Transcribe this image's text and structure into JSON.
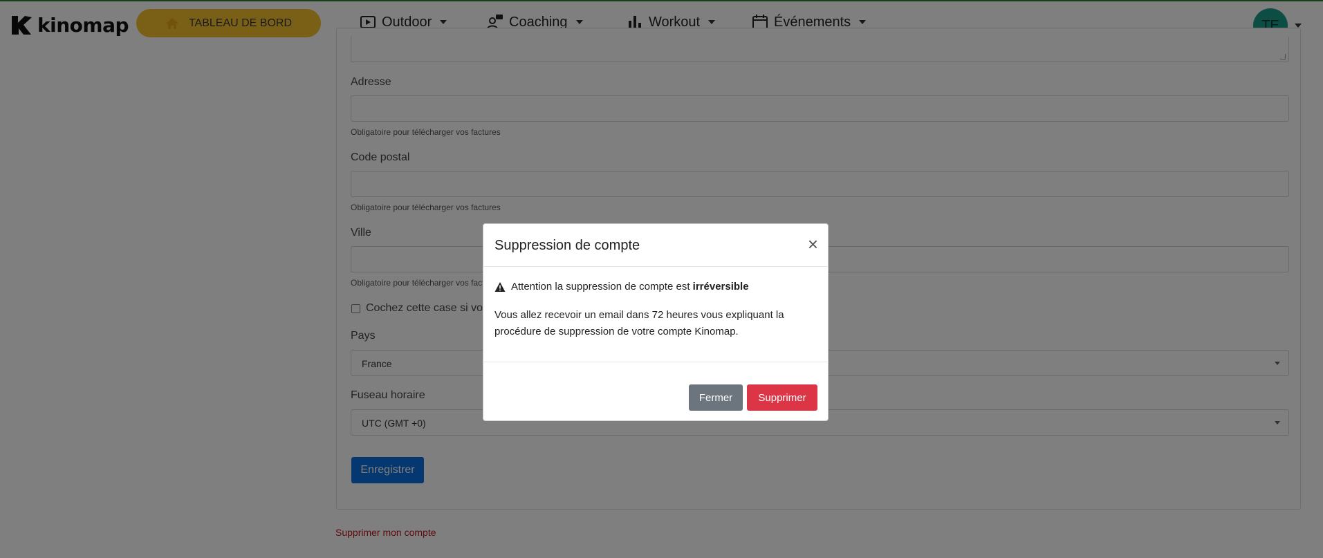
{
  "navbar": {
    "logo_text": "kinomap",
    "dashboard_label": "TABLEAU DE BORD",
    "items": [
      {
        "label": "Outdoor",
        "icon": "play-icon"
      },
      {
        "label": "Coaching",
        "icon": "coach-icon"
      },
      {
        "label": "Workout",
        "icon": "bar-chart-icon"
      },
      {
        "label": "Événements",
        "icon": "calendar-icon"
      }
    ],
    "avatar_initials": "TE"
  },
  "form": {
    "address_label": "Adresse",
    "address_help": "Obligatoire pour télécharger vos factures",
    "postal_label": "Code postal",
    "postal_help": "Obligatoire pour télécharger vos factures",
    "city_label": "Ville",
    "city_help": "Obligatoire pour télécharger vos factures",
    "checkbox_label": "Cochez cette case si vous",
    "country_label": "Pays",
    "country_value": "France",
    "timezone_label": "Fuseau horaire",
    "timezone_value": "UTC (GMT +0)",
    "save_label": "Enregistrer",
    "delete_account_link": "Supprimer mon compte"
  },
  "modal": {
    "title": "Suppression de compte",
    "close_symbol": "×",
    "warning_text": "Attention la suppression de compte est",
    "warning_bold": "irréversible",
    "message": "Vous allez recevoir un email dans 72 heures vous expliquant la procédure de suppression de votre compte Kinomap.",
    "btn_close": "Fermer",
    "btn_delete": "Supprimer"
  },
  "colors": {
    "dashboard_bg": "#f5c12e",
    "avatar_bg": "#1a9b86",
    "primary": "#0b6fe0",
    "danger": "#dc3545",
    "secondary": "#6c757d",
    "link_danger": "#c0141b"
  }
}
